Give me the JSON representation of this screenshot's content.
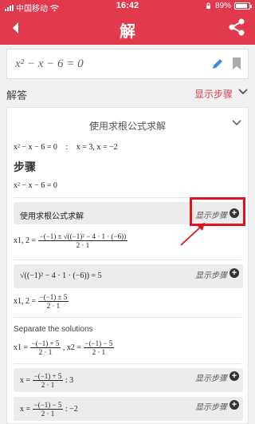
{
  "status": {
    "carrier": "中国移动",
    "time": "16:42",
    "battery": "89%",
    "battery_level": 0.89
  },
  "header": {
    "title": "解"
  },
  "equation": {
    "text": "x² − x − 6 = 0"
  },
  "answer": {
    "label": "解答",
    "show_steps": "显示步骤"
  },
  "card": {
    "title": "使用求根公式求解",
    "summary_eq": "x² − x − 6 = 0",
    "summary_sep": ":",
    "summary_result": "x = 3, x = −2",
    "steps_heading": "步骤",
    "first_eq": "x² − x − 6 = 0",
    "step1": {
      "label": "使用求根公式求解",
      "show": "显示步骤"
    },
    "formula": {
      "lhs": "x1, 2 =",
      "num": "−(−1) ± √((−1)² − 4 · 1 · (−6))",
      "den": "2 · 1"
    },
    "step2": {
      "expr": "√((−1)² − 4 · 1 · (−6)) = 5",
      "show": "显示步骤"
    },
    "x12": {
      "lhs": "x1, 2 =",
      "num": "−(−1) ± 5",
      "den": "2 · 1"
    },
    "separate": "Separate the solutions",
    "sols": {
      "x1": "x1 =",
      "x1_num": "−(−1) + 5",
      "x1_den": "2 · 1",
      "x2": ", x2 =",
      "x2_num": "−(−1) − 5",
      "x2_den": "2 · 1"
    },
    "step3": {
      "lhs": "x =",
      "num": "−(−1) + 5",
      "den": "2 · 1",
      "res": ":   3",
      "show": "显示步骤"
    },
    "step4": {
      "lhs": "x =",
      "num": "−(−1) − 5",
      "den": "2 · 1",
      "res": ":   −2",
      "show": "显示步骤"
    }
  },
  "colors": {
    "brand": "#e03a4c",
    "highlight": "#e0141e"
  }
}
